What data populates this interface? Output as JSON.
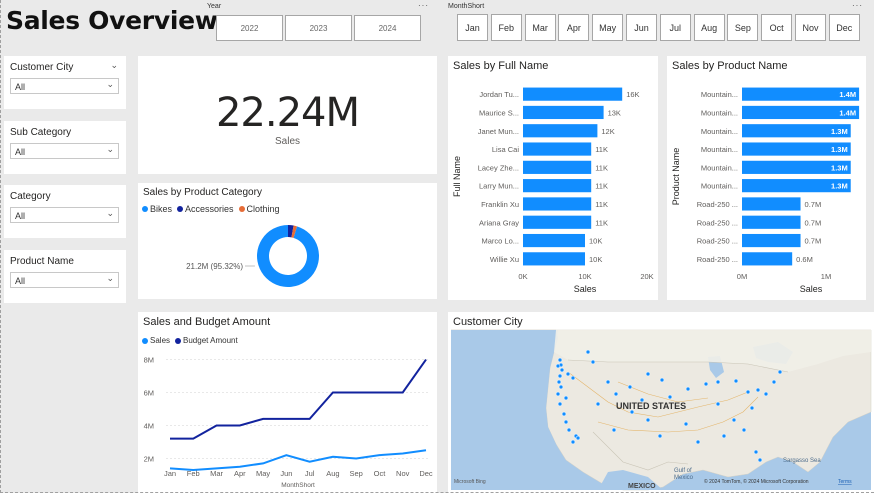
{
  "page_title": "Sales Overview",
  "year_slicer": {
    "label": "Year",
    "options": [
      "2022",
      "2023",
      "2024"
    ]
  },
  "month_slicer": {
    "label": "MonthShort",
    "options": [
      "Jan",
      "Feb",
      "Mar",
      "Apr",
      "May",
      "Jun",
      "Jul",
      "Aug",
      "Sep",
      "Oct",
      "Nov",
      "Dec"
    ]
  },
  "filters": [
    {
      "title": "Customer City",
      "value": "All"
    },
    {
      "title": "Sub Category",
      "value": "All"
    },
    {
      "title": "Category",
      "value": "All"
    },
    {
      "title": "Product Name",
      "value": "All"
    }
  ],
  "kpi": {
    "value": "22.24M",
    "label": "Sales"
  },
  "category_chart": {
    "title": "Sales by Product Category",
    "legend": [
      {
        "name": "Bikes",
        "color": "#118dff"
      },
      {
        "name": "Accessories",
        "color": "#12239e"
      },
      {
        "name": "Clothing",
        "color": "#e66c37"
      }
    ],
    "data_label": "21.2M (95.32%)"
  },
  "fullname_chart": {
    "title": "Sales by Full Name",
    "ylabel": "Full Name",
    "xlabel": "Sales",
    "ticks": [
      "0K",
      "10K",
      "20K"
    ]
  },
  "product_chart": {
    "title": "Sales by Product Name",
    "ylabel": "Product Name",
    "xlabel": "Sales",
    "ticks": [
      "0M",
      "1M"
    ]
  },
  "budget_chart": {
    "title": "Sales and Budget Amount",
    "legend": [
      {
        "name": "Sales",
        "color": "#118dff"
      },
      {
        "name": "Budget Amount",
        "color": "#12239e"
      }
    ],
    "xlabel": "MonthShort",
    "y_ticks": [
      "8M",
      "6M",
      "4M",
      "2M"
    ]
  },
  "map": {
    "title": "Customer City",
    "label_country": "UNITED STATES",
    "label_mexico": "MEXICO",
    "label_gulf": "Gulf of\nMexico",
    "label_sargasso": "Sargasso Sea",
    "bing": "Microsoft Bing",
    "copyright": "© 2024 TomTom, © 2024 Microsoft Corporation",
    "terms": "Terms"
  },
  "chart_data": [
    {
      "type": "pie",
      "title": "Sales by Product Category",
      "categories": [
        "Bikes",
        "Accessories",
        "Clothing"
      ],
      "values": [
        95.32,
        2.9,
        1.78
      ]
    },
    {
      "type": "bar",
      "title": "Sales by Full Name",
      "xlabel": "Sales",
      "ylabel": "Full Name",
      "categories": [
        "Jordan Tu...",
        "Maurice S...",
        "Janet Mun...",
        "Lisa Cai",
        "Lacey Zhe...",
        "Larry Mun...",
        "Franklin Xu",
        "Ariana Gray",
        "Marco Lo...",
        "Willie Xu"
      ],
      "values": [
        16000,
        13000,
        12000,
        11000,
        11000,
        11000,
        11000,
        11000,
        10000,
        10000
      ],
      "data_labels": [
        "16K",
        "13K",
        "12K",
        "11K",
        "11K",
        "11K",
        "11K",
        "11K",
        "10K",
        "10K"
      ],
      "xlim": [
        0,
        20000
      ]
    },
    {
      "type": "bar",
      "title": "Sales by Product Name",
      "xlabel": "Sales",
      "ylabel": "Product Name",
      "categories": [
        "Mountain...",
        "Mountain...",
        "Mountain...",
        "Mountain...",
        "Mountain...",
        "Mountain...",
        "Road-250 ...",
        "Road-250 ...",
        "Road-250 ...",
        "Road-250 ..."
      ],
      "values": [
        1.4,
        1.4,
        1.3,
        1.3,
        1.3,
        1.3,
        0.7,
        0.7,
        0.7,
        0.6
      ],
      "data_labels": [
        "1.4M",
        "1.4M",
        "1.3M",
        "1.3M",
        "1.3M",
        "1.3M",
        "0.7M",
        "0.7M",
        "0.7M",
        "0.6M"
      ],
      "xlim": [
        0,
        1.65
      ]
    },
    {
      "type": "line",
      "title": "Sales and Budget Amount",
      "xlabel": "MonthShort",
      "x": [
        "Jan",
        "Feb",
        "Mar",
        "Apr",
        "May",
        "Jun",
        "Jul",
        "Aug",
        "Sep",
        "Oct",
        "Nov",
        "Dec"
      ],
      "series": [
        {
          "name": "Sales",
          "values": [
            1.4,
            1.3,
            1.4,
            1.5,
            1.7,
            2.2,
            1.8,
            2.1,
            2.0,
            2.2,
            2.3,
            2.5
          ]
        },
        {
          "name": "Budget Amount",
          "values": [
            3.2,
            3.2,
            4.0,
            4.0,
            4.4,
            4.4,
            4.4,
            6.0,
            6.0,
            6.0,
            6.0,
            8.0
          ]
        }
      ],
      "ylim": [
        1.3,
        8.7
      ]
    }
  ]
}
